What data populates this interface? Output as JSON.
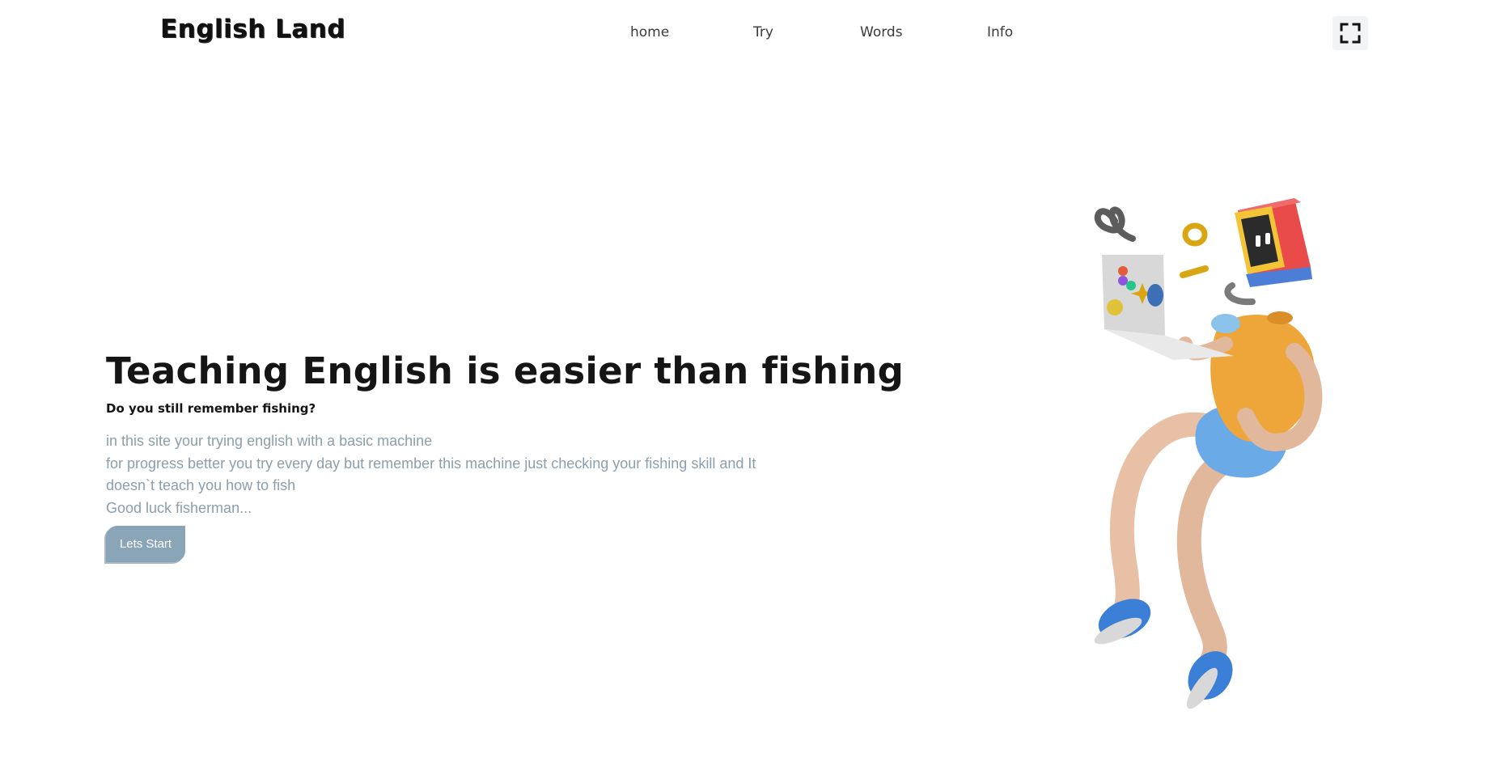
{
  "header": {
    "logo": "English Land",
    "nav": [
      {
        "label": "home"
      },
      {
        "label": "Try"
      },
      {
        "label": "Words"
      },
      {
        "label": "Info"
      }
    ],
    "fullscreen_icon": "fullscreen-icon"
  },
  "hero": {
    "title": "Teaching English is easier than fishing",
    "subtitle": "Do you still remember fishing?",
    "lines": [
      "in this site your trying english with a basic machine",
      "for progress better you try every day but remember this machine just checking your fishing skill and It",
      "doesn`t teach you how to fish",
      "Good luck fisherman..."
    ],
    "button_label": "Lets Start"
  },
  "colors": {
    "accent": "#8aa5b8",
    "text_muted": "#8c9eac",
    "heading": "#151515"
  }
}
